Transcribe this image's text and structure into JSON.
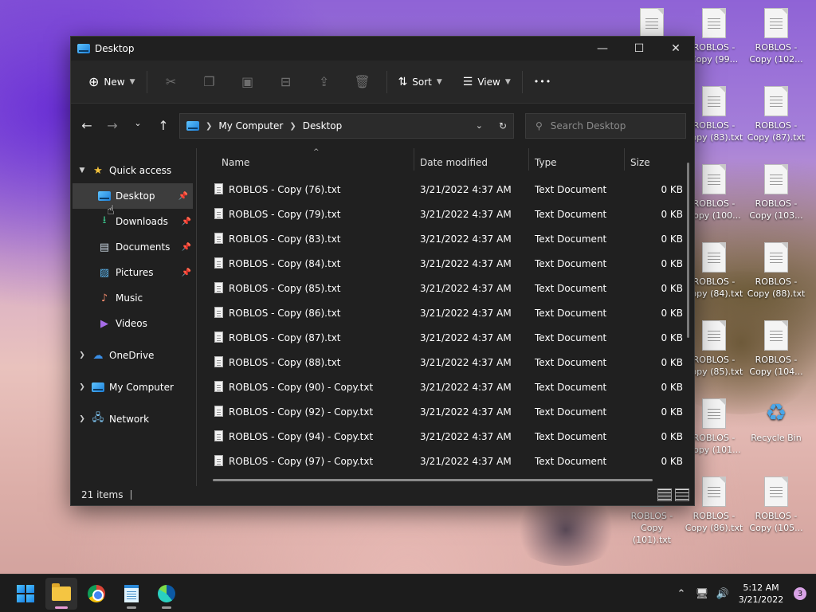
{
  "window": {
    "title": "Desktop",
    "controls": {
      "minimize": "—",
      "maximize": "☐",
      "close": "✕"
    }
  },
  "commandbar": {
    "new_label": "New",
    "sort_label": "Sort",
    "view_label": "View",
    "more_label": "•••"
  },
  "address": {
    "crumbs": [
      "My Computer",
      "Desktop"
    ]
  },
  "search": {
    "placeholder": "Search Desktop"
  },
  "sidebar": {
    "quick_access": "Quick access",
    "items": [
      {
        "label": "Desktop"
      },
      {
        "label": "Downloads"
      },
      {
        "label": "Documents"
      },
      {
        "label": "Pictures"
      },
      {
        "label": "Music"
      },
      {
        "label": "Videos"
      }
    ],
    "onedrive": "OneDrive",
    "my_computer": "My Computer",
    "network": "Network"
  },
  "columns": {
    "name": "Name",
    "date": "Date modified",
    "type": "Type",
    "size": "Size"
  },
  "files": [
    {
      "name": "ROBLOS - Copy (76).txt",
      "date": "3/21/2022 4:37 AM",
      "type": "Text Document",
      "size": "0 KB"
    },
    {
      "name": "ROBLOS - Copy (79).txt",
      "date": "3/21/2022 4:37 AM",
      "type": "Text Document",
      "size": "0 KB"
    },
    {
      "name": "ROBLOS - Copy (83).txt",
      "date": "3/21/2022 4:37 AM",
      "type": "Text Document",
      "size": "0 KB"
    },
    {
      "name": "ROBLOS - Copy (84).txt",
      "date": "3/21/2022 4:37 AM",
      "type": "Text Document",
      "size": "0 KB"
    },
    {
      "name": "ROBLOS - Copy (85).txt",
      "date": "3/21/2022 4:37 AM",
      "type": "Text Document",
      "size": "0 KB"
    },
    {
      "name": "ROBLOS - Copy (86).txt",
      "date": "3/21/2022 4:37 AM",
      "type": "Text Document",
      "size": "0 KB"
    },
    {
      "name": "ROBLOS - Copy (87).txt",
      "date": "3/21/2022 4:37 AM",
      "type": "Text Document",
      "size": "0 KB"
    },
    {
      "name": "ROBLOS - Copy (88).txt",
      "date": "3/21/2022 4:37 AM",
      "type": "Text Document",
      "size": "0 KB"
    },
    {
      "name": "ROBLOS - Copy (90) - Copy.txt",
      "date": "3/21/2022 4:37 AM",
      "type": "Text Document",
      "size": "0 KB"
    },
    {
      "name": "ROBLOS - Copy (92) - Copy.txt",
      "date": "3/21/2022 4:37 AM",
      "type": "Text Document",
      "size": "0 KB"
    },
    {
      "name": "ROBLOS - Copy (94) - Copy.txt",
      "date": "3/21/2022 4:37 AM",
      "type": "Text Document",
      "size": "0 KB"
    },
    {
      "name": "ROBLOS - Copy (97) - Copy.txt",
      "date": "3/21/2022 4:37 AM",
      "type": "Text Document",
      "size": "0 KB"
    }
  ],
  "status": {
    "item_count": "21 items"
  },
  "desktop_icons": [
    {
      "l1": "",
      "l2": ""
    },
    {
      "l1": "ROBLOS -",
      "l2": "Copy (99..."
    },
    {
      "l1": "ROBLOS -",
      "l2": "Copy (102..."
    },
    {
      "l1": "ROBLOS -",
      "l2": "Copy (83).txt"
    },
    {
      "l1": "ROBLOS -",
      "l2": "Copy (87).txt"
    },
    {
      "l1": "ROBLOS -",
      "l2": "Copy (100..."
    },
    {
      "l1": "ROBLOS -",
      "l2": "Copy (103..."
    },
    {
      "l1": "ROBLOS -",
      "l2": "Copy (84).txt"
    },
    {
      "l1": "ROBLOS -",
      "l2": "Copy (88).txt"
    },
    {
      "l1": "ROBLOS -",
      "l2": "Copy (85).txt"
    },
    {
      "l1": "ROBLOS -",
      "l2": "Copy (104..."
    },
    {
      "l1": "ROBLOS -",
      "l2": "Copy (101..."
    },
    {
      "l1": "Recycle Bin",
      "l2": ""
    },
    {
      "l1": "ROBLOS -",
      "l2": "Copy (101).txt"
    },
    {
      "l1": "ROBLOS -",
      "l2": "Copy (86).txt"
    },
    {
      "l1": "ROBLOS -",
      "l2": "Copy (105..."
    }
  ],
  "taskbar": {
    "time": "5:12 AM",
    "date": "3/21/2022",
    "notification_count": "3"
  }
}
